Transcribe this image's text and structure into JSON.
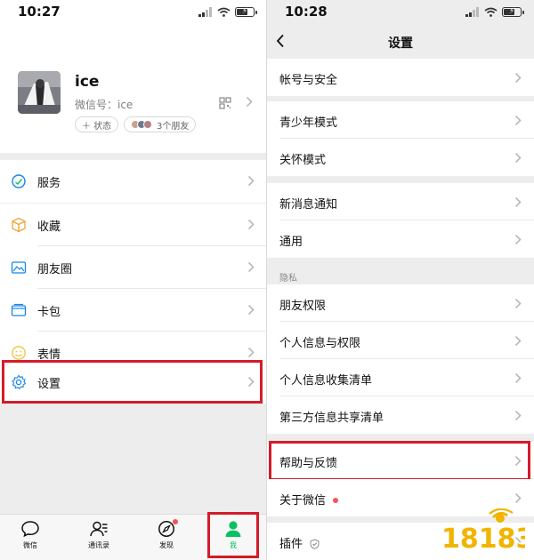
{
  "left": {
    "status": {
      "time": "10:27"
    },
    "profile": {
      "name": "ice",
      "wechat_id": "微信号：ice",
      "status_pill": "＋ 状态",
      "friends_pill": "3个朋友"
    },
    "menu": [
      {
        "label": "服务",
        "icon": "service-icon"
      },
      {
        "label": "收藏",
        "icon": "favorites-icon"
      },
      {
        "label": "朋友圈",
        "icon": "moments-icon"
      },
      {
        "label": "卡包",
        "icon": "card-wallet-icon"
      },
      {
        "label": "表情",
        "icon": "sticker-icon"
      },
      {
        "label": "设置",
        "icon": "settings-gear-icon"
      }
    ],
    "tabs": [
      {
        "label": "微信",
        "icon": "chat-bubble-icon"
      },
      {
        "label": "通讯录",
        "icon": "contacts-icon"
      },
      {
        "label": "发现",
        "icon": "discover-compass-icon"
      },
      {
        "label": "我",
        "icon": "me-person-icon"
      }
    ]
  },
  "right": {
    "status": {
      "time": "10:28"
    },
    "title": "设置",
    "items": [
      {
        "label": "帐号与安全"
      },
      {
        "label": "青少年模式"
      },
      {
        "label": "关怀模式"
      },
      {
        "label": "新消息通知"
      },
      {
        "label": "通用"
      },
      {
        "label": "朋友权限"
      },
      {
        "label": "个人信息与权限"
      },
      {
        "label": "个人信息收集清单"
      },
      {
        "label": "第三方信息共享清单"
      },
      {
        "label": "帮助与反馈"
      },
      {
        "label": "关于微信"
      },
      {
        "label": "插件"
      }
    ],
    "privacy_section": "隐私"
  },
  "watermark": "18183",
  "colors": {
    "accent_green": "#07c160",
    "highlight_red": "#d51b2a",
    "background_gray": "#ededed",
    "notification_red": "#fa5151"
  }
}
